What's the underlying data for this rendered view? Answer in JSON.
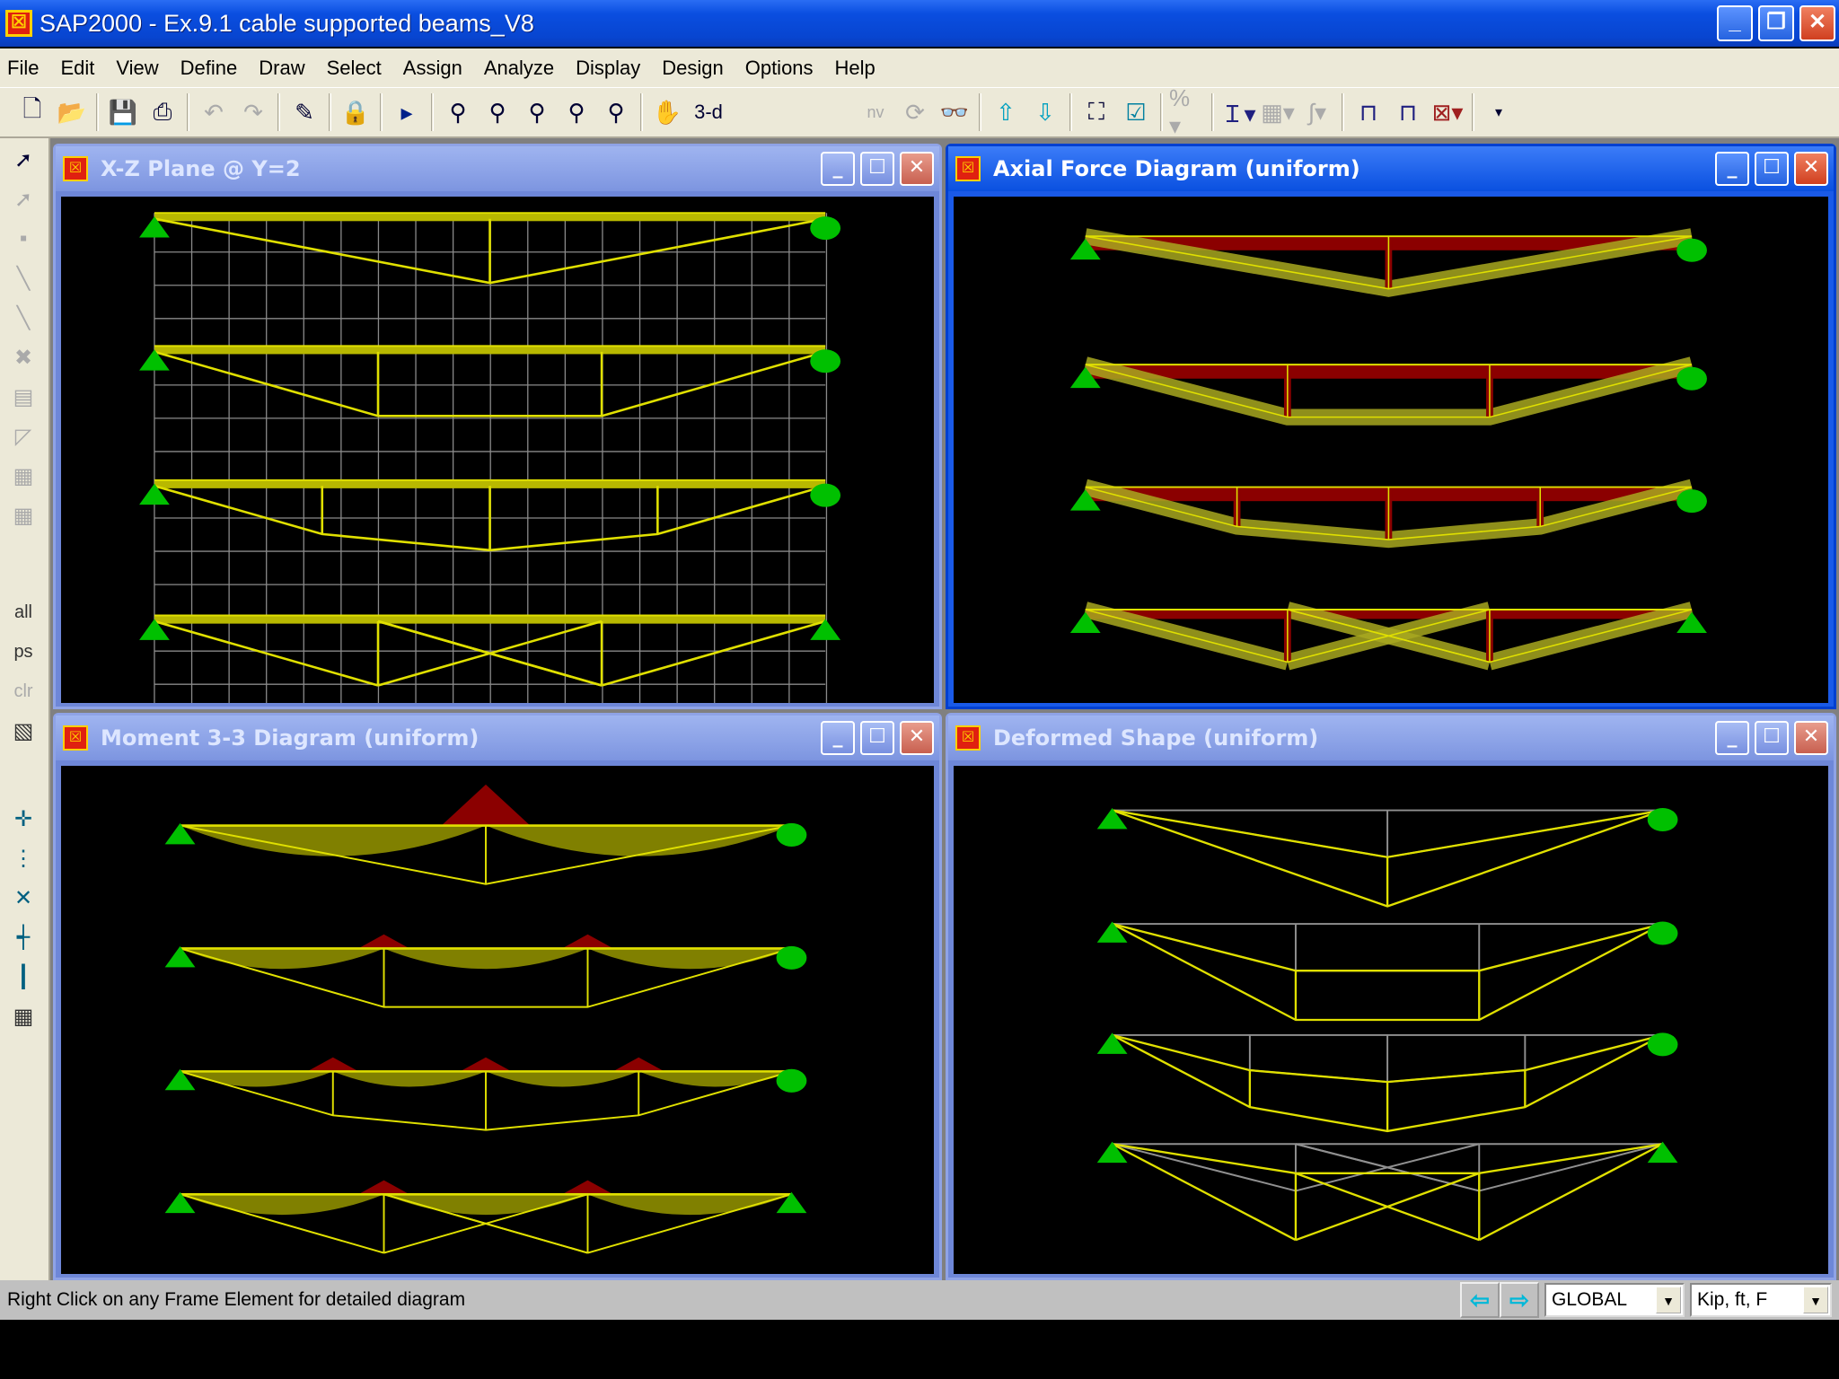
{
  "window": {
    "title": "SAP2000 - Ex.9.1 cable supported beams_V8",
    "icon": "sap-logo-icon"
  },
  "menu": [
    "File",
    "Edit",
    "View",
    "Define",
    "Draw",
    "Select",
    "Assign",
    "Analyze",
    "Display",
    "Design",
    "Options",
    "Help"
  ],
  "toolbar": {
    "view_label": "3-d",
    "nv_label": "nv"
  },
  "left_toolbar": {
    "all": "all",
    "ps": "ps",
    "clr": "clr"
  },
  "panels": [
    {
      "title": "X-Z Plane @ Y=2",
      "active": false
    },
    {
      "title": "Axial Force Diagram   (uniform)",
      "active": true
    },
    {
      "title": "Moment 3-3 Diagram   (uniform)",
      "active": false
    },
    {
      "title": "Deformed Shape (uniform)",
      "active": false
    }
  ],
  "status": {
    "message": "Right Click on any Frame Element for detailed diagram",
    "coord_system": "GLOBAL",
    "units": "Kip, ft, F"
  },
  "colors": {
    "beam": "#e0e000",
    "support": "#00c000",
    "axial_neg": "#8b0000",
    "fill": "#808000",
    "title_active": "#0a50e0"
  }
}
